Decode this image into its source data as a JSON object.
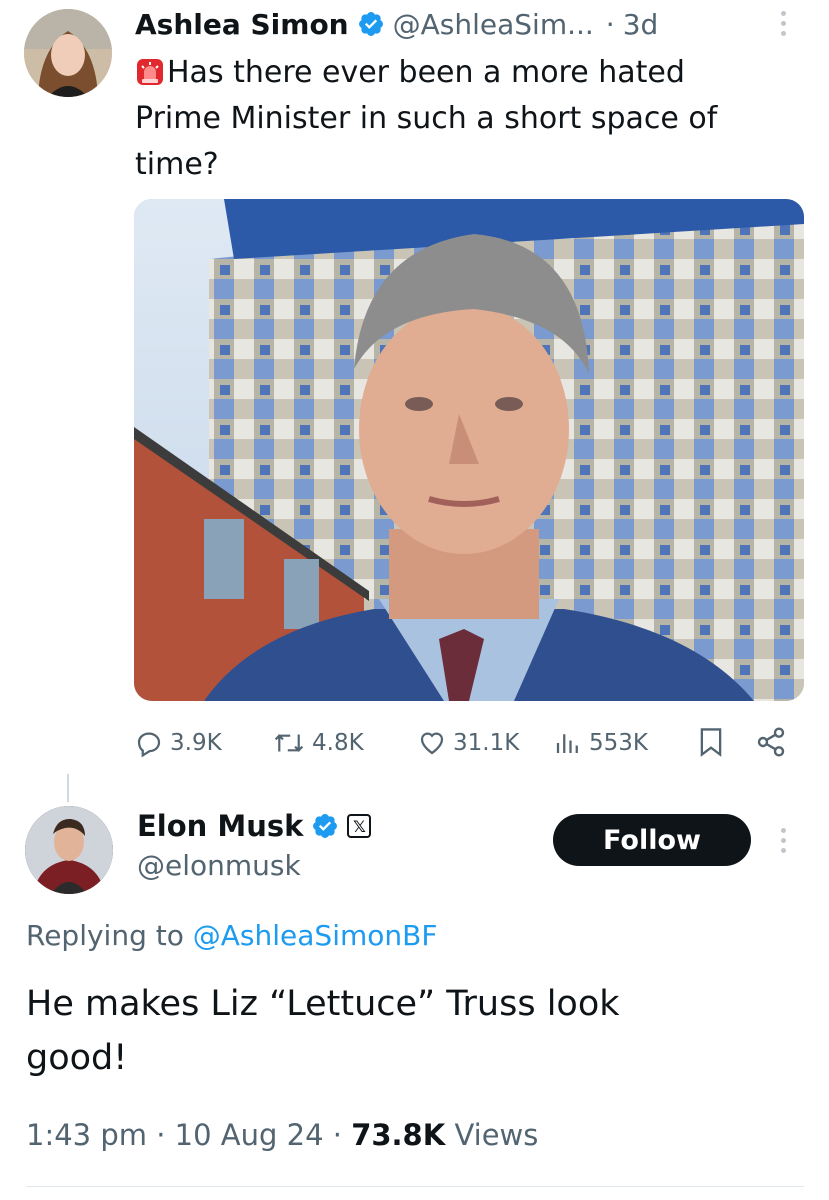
{
  "tweet": {
    "author_name": "Ashlea Simon",
    "handle": "@AshleaSim...",
    "separator": "·",
    "age": "3d",
    "text": "Has there ever been a more hated Prime Minister in such a short space of time?",
    "siren_icon": "siren-emoji-icon",
    "stats": {
      "replies": "3.9K",
      "retweets": "4.8K",
      "likes": "31.1K",
      "views": "553K"
    }
  },
  "reply": {
    "author_name": "Elon Musk",
    "handle": "@elonmusk",
    "follow_label": "Follow",
    "replying_prefix": "Replying to",
    "replying_handle": "@AshleaSimonBF",
    "text": "He makes Liz “Lettuce” Truss look good!",
    "time": "1:43 pm",
    "dot1": "·",
    "date": "10 Aug 24",
    "dot2": "·",
    "views_count": "73.8K",
    "views_label": "Views"
  },
  "colors": {
    "verified": "#1d9bf0",
    "link": "#1d9bf0",
    "muted": "#536471",
    "text": "#0f1419"
  }
}
